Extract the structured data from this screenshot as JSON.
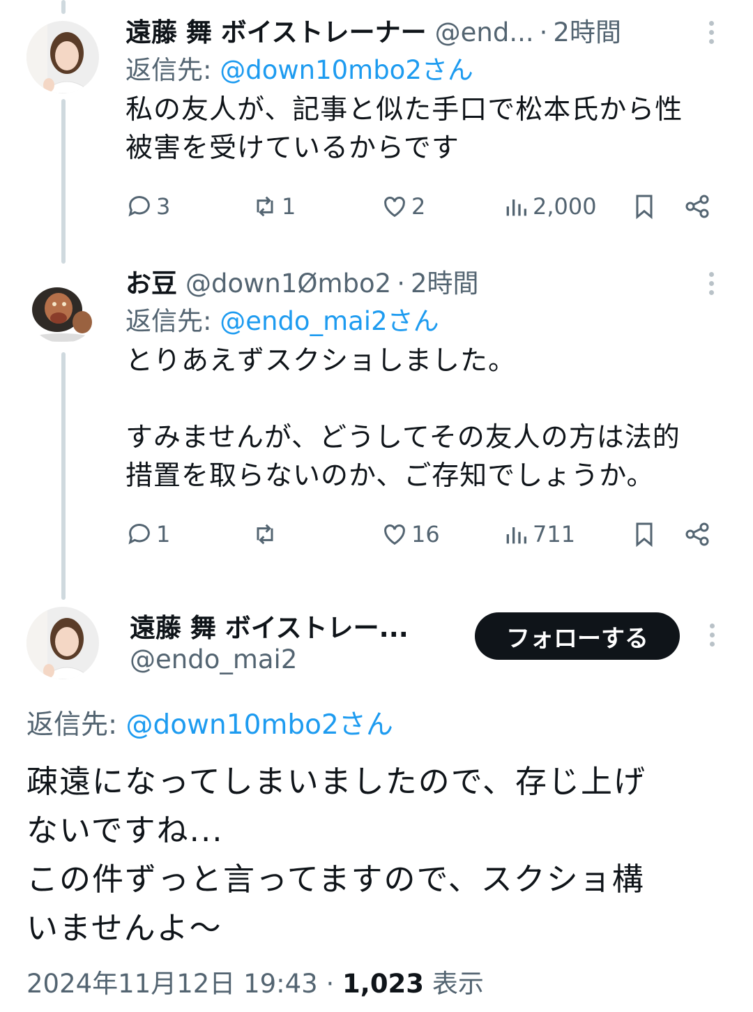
{
  "tweets": [
    {
      "name": "遠藤 舞 ボイストレーナー",
      "handle": "@end...",
      "time": "2時間",
      "reply_prefix": "返信先:",
      "reply_mention": "@down10mbo2さん",
      "text_lines": [
        "私の友人が、記事と似た手口で松本氏から性",
        "被害を受けているからです"
      ],
      "replies": "3",
      "retweets": "1",
      "likes": "2",
      "views": "2,000"
    },
    {
      "name": "お豆",
      "handle": "@down1Ømbo2",
      "time": "2時間",
      "reply_prefix": "返信先:",
      "reply_mention": "@endo_mai2さん",
      "text_lines": [
        "とりあえずスクショしました。",
        "",
        "すみませんが、どうしてその友人の方は法的",
        "措置を取らないのか、ご存知でしょうか。"
      ],
      "replies": "1",
      "retweets": "",
      "likes": "16",
      "views": "711"
    }
  ],
  "main_tweet": {
    "name": "遠藤 舞 ボイストレー...",
    "handle": "@endo_mai2",
    "follow_label": "フォローする",
    "reply_prefix": "返信先:",
    "reply_mention": "@down10mbo2さん",
    "text_lines": [
      "疎遠になってしまいましたので、存じ上げ",
      "ないですね...",
      "この件ずっと言ってますので、スクショ構",
      "いませんよ〜"
    ],
    "timestamp": "2024年11月12日 19:43",
    "views_count": "1,023",
    "views_label": "表示"
  },
  "separator": "·",
  "icons": {
    "reply": "reply-icon",
    "retweet": "retweet-icon",
    "like": "heart-icon",
    "views": "views-icon",
    "bookmark": "bookmark-icon",
    "share": "share-icon",
    "more": "more-icon"
  },
  "colors": {
    "accent": "#1d9bf0",
    "text": "#0f1419",
    "secondary": "#536471",
    "thread_line": "#cfd9de"
  }
}
